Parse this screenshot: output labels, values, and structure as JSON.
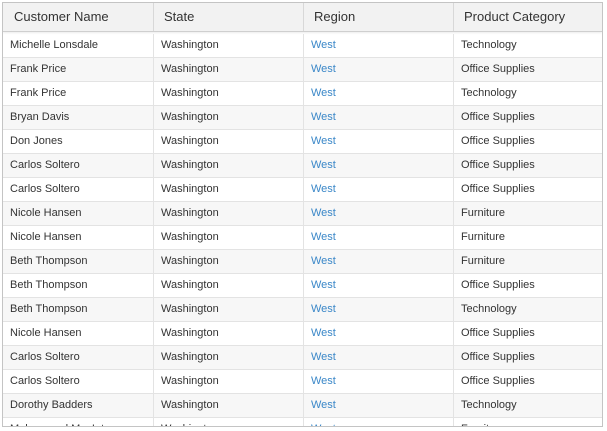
{
  "columns": [
    "Customer Name",
    "State",
    "Region",
    "Product Category"
  ],
  "colors": {
    "link": "#3a87c8",
    "header_bg": "#f2f2f2",
    "alt_row": "#f7f7f7"
  },
  "rows": [
    [
      "Michelle Lonsdale",
      "Washington",
      "West",
      "Technology"
    ],
    [
      "Frank Price",
      "Washington",
      "West",
      "Office Supplies"
    ],
    [
      "Frank Price",
      "Washington",
      "West",
      "Technology"
    ],
    [
      "Bryan Davis",
      "Washington",
      "West",
      "Office Supplies"
    ],
    [
      "Don Jones",
      "Washington",
      "West",
      "Office Supplies"
    ],
    [
      "Carlos Soltero",
      "Washington",
      "West",
      "Office Supplies"
    ],
    [
      "Carlos Soltero",
      "Washington",
      "West",
      "Office Supplies"
    ],
    [
      "Nicole Hansen",
      "Washington",
      "West",
      "Furniture"
    ],
    [
      "Nicole Hansen",
      "Washington",
      "West",
      "Furniture"
    ],
    [
      "Beth Thompson",
      "Washington",
      "West",
      "Furniture"
    ],
    [
      "Beth Thompson",
      "Washington",
      "West",
      "Office Supplies"
    ],
    [
      "Beth Thompson",
      "Washington",
      "West",
      "Technology"
    ],
    [
      "Nicole Hansen",
      "Washington",
      "West",
      "Office Supplies"
    ],
    [
      "Carlos Soltero",
      "Washington",
      "West",
      "Office Supplies"
    ],
    [
      "Carlos Soltero",
      "Washington",
      "West",
      "Office Supplies"
    ],
    [
      "Dorothy Badders",
      "Washington",
      "West",
      "Technology"
    ],
    [
      "Muhammed MacIntyre",
      "Washington",
      "West",
      "Furniture"
    ]
  ]
}
